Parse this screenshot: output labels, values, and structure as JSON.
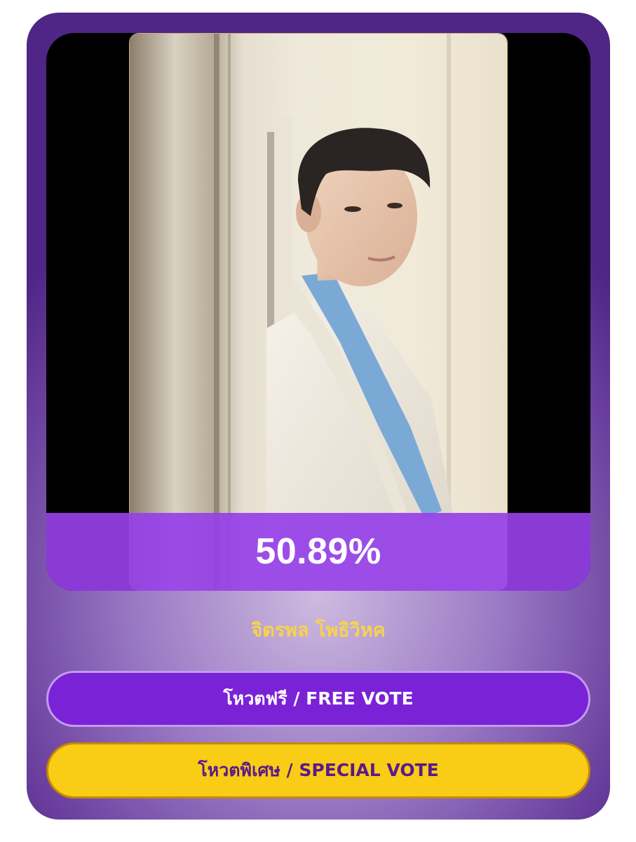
{
  "candidate": {
    "vote_percent": "50.89%",
    "name": "จิตรพล โพธิวิหค"
  },
  "buttons": {
    "free_vote_label": "โหวตฟรี / FREE VOTE",
    "special_vote_label": "โหวตพิเศษ / SPECIAL VOTE"
  },
  "colors": {
    "card_purple": "#6a3f9e",
    "percent_bar": "#9640e8",
    "name_gold": "#f6d34d",
    "free_button": "#7a22d6",
    "special_button": "#f9cc16",
    "special_button_text": "#5a1a8a"
  }
}
